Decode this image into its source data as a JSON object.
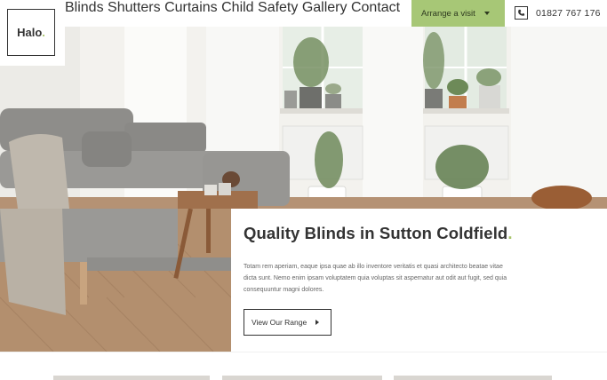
{
  "logo": {
    "text": "Halo",
    "dot": "."
  },
  "nav": {
    "items": [
      "Blinds",
      "Shutters",
      "Curtains",
      "Child Safety",
      "Gallery",
      "Contact"
    ]
  },
  "cta": {
    "label": "Arrange a visit"
  },
  "phone": {
    "number": "01827 767 176"
  },
  "hero": {
    "title": "Quality Blinds in Sutton Coldfield",
    "title_dot": ".",
    "body": "Totam rem aperiam, eaque ipsa quae ab illo inventore veritatis et quasi architecto beatae vitae dicta sunt. Nemo enim ipsam voluptatem quia voluptas sit aspernatur aut odit aut fugit, sed quia consequuntur magni dolores.",
    "button_label": "View Our Range"
  },
  "colors": {
    "accent": "#a7c776",
    "text": "#333333"
  }
}
